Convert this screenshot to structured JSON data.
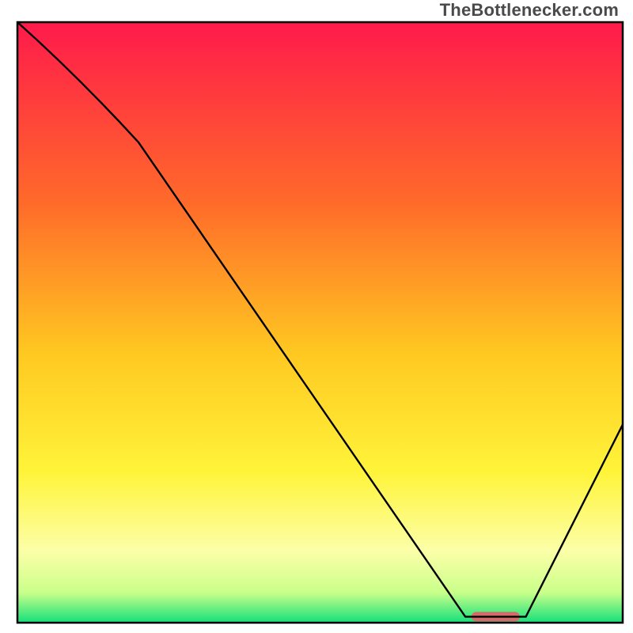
{
  "watermark": "TheBottlenecker.com",
  "chart_data": {
    "type": "line",
    "title": "",
    "xlabel": "",
    "ylabel": "",
    "xlim": [
      0,
      100
    ],
    "ylim": [
      0,
      100
    ],
    "grid": false,
    "legend": false,
    "x": [
      0,
      20,
      74,
      84,
      100
    ],
    "values": [
      100,
      80,
      1,
      1,
      33
    ],
    "feature": {
      "type": "bar",
      "x_start": 75,
      "x_end": 83,
      "y": 1,
      "color": "#d46a6a"
    },
    "background_gradient": {
      "stops": [
        {
          "offset": 0.0,
          "color": "#ff1a4b"
        },
        {
          "offset": 0.3,
          "color": "#ff6a2a"
        },
        {
          "offset": 0.55,
          "color": "#ffc821"
        },
        {
          "offset": 0.75,
          "color": "#fff43a"
        },
        {
          "offset": 0.88,
          "color": "#fcffa8"
        },
        {
          "offset": 0.95,
          "color": "#c9ff8a"
        },
        {
          "offset": 1.0,
          "color": "#14e07a"
        }
      ]
    },
    "frame_color": "#000000",
    "line_color": "#000000",
    "line_width": 2.4
  }
}
